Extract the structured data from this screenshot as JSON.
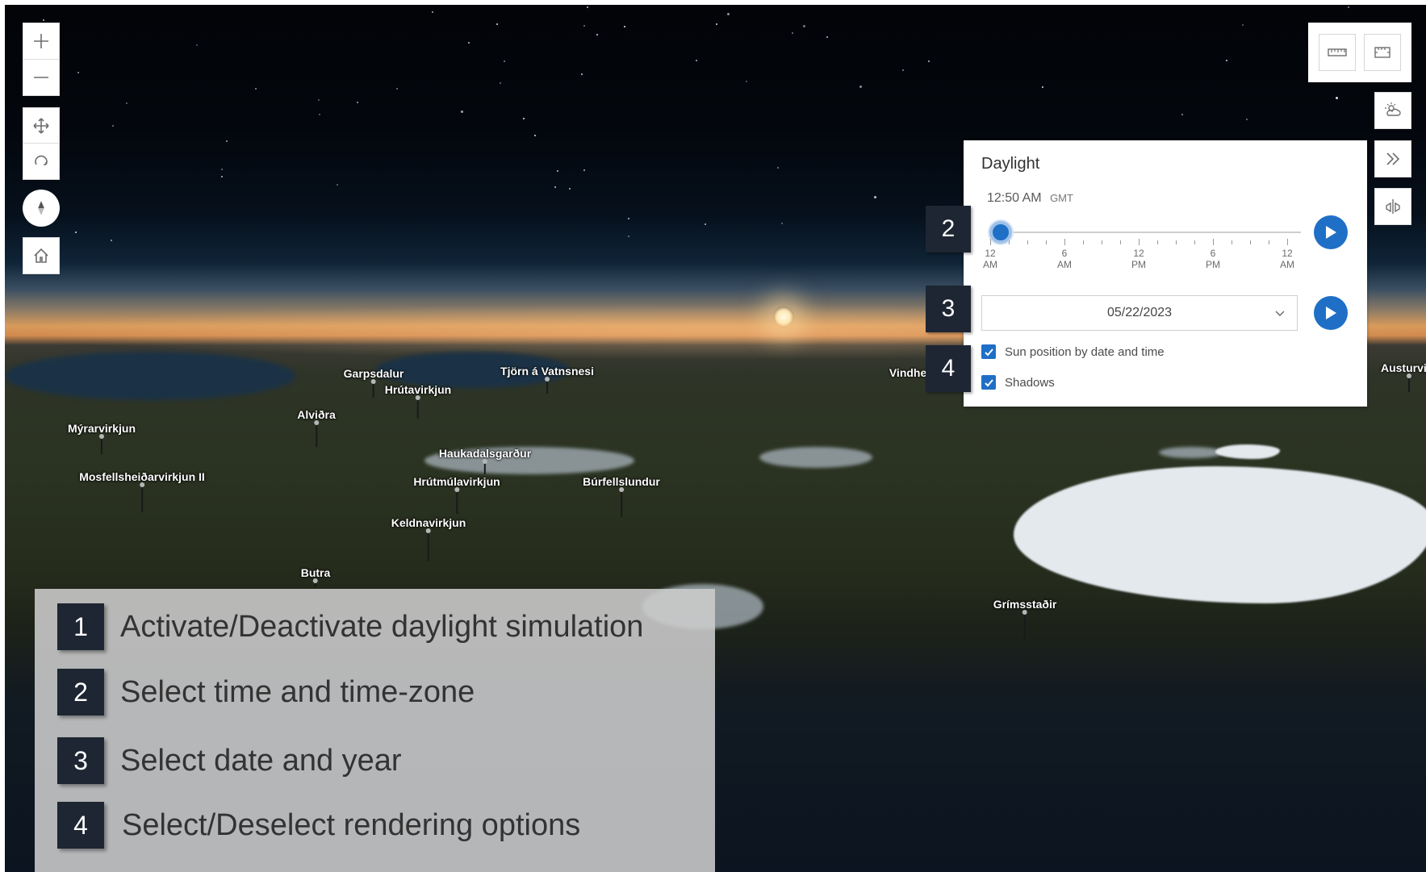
{
  "map": {
    "places": [
      {
        "name": "Garpsdalur"
      },
      {
        "name": "Tjörn á Vatnsnesi"
      },
      {
        "name": "Hrútavirkjun"
      },
      {
        "name": "Alviðra"
      },
      {
        "name": "Mýrarvirkjun"
      },
      {
        "name": "Haukadalsgarður"
      },
      {
        "name": "Mosfellsheiðarvirkjun II"
      },
      {
        "name": "Hrútmúlavirkjun"
      },
      {
        "name": "Búrfellslundur"
      },
      {
        "name": "Keldnavirkjun"
      },
      {
        "name": "Butra"
      },
      {
        "name": "Vindhei"
      },
      {
        "name": "Grímsstaðir"
      },
      {
        "name": "Austurvirk"
      }
    ]
  },
  "nav_controls": {
    "zoom_in": "zoom-in-icon",
    "zoom_out": "zoom-out-icon",
    "pan": "pan-icon",
    "rotate": "rotate-icon",
    "compass": "compass-icon",
    "home": "home-icon"
  },
  "right_toolbar": {
    "measure_line": "line-measure-icon",
    "measure_area": "area-measure-icon",
    "daylight": "daylight-icon",
    "expand": "double-chevron-right-icon",
    "slice": "slice-icon"
  },
  "daylight": {
    "title": "Daylight",
    "time": "12:50 AM",
    "timezone": "GMT",
    "slider_value_fraction": 0.035,
    "ticks": [
      {
        "top": "12",
        "bottom": "AM"
      },
      {
        "top": "6",
        "bottom": "AM"
      },
      {
        "top": "12",
        "bottom": "PM"
      },
      {
        "top": "6",
        "bottom": "PM"
      },
      {
        "top": "12",
        "bottom": "AM"
      }
    ],
    "date": "05/22/2023",
    "options": [
      {
        "label": "Sun position by date and time",
        "checked": true
      },
      {
        "label": "Shadows",
        "checked": true
      }
    ]
  },
  "badges": [
    "2",
    "3",
    "4"
  ],
  "legend": [
    {
      "num": "1",
      "text": "Activate/Deactivate daylight simulation"
    },
    {
      "num": "2",
      "text": "Select time and time-zone"
    },
    {
      "num": "3",
      "text": "Select date and year"
    },
    {
      "num": "4",
      "text": "Select/Deselect rendering options"
    }
  ],
  "colors": {
    "accent": "#1f6fc6",
    "badge": "#1e2633"
  }
}
